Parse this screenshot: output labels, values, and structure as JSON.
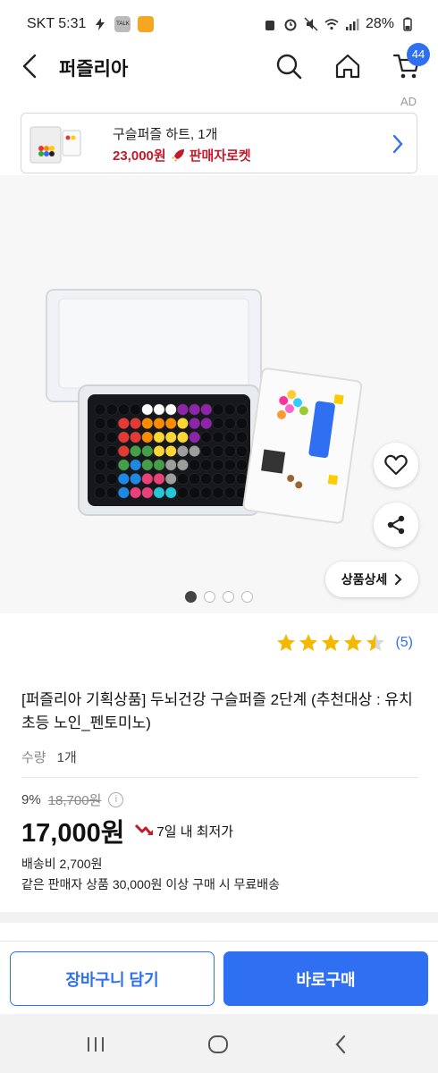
{
  "status_bar": {
    "carrier_time": "SKT 5:31",
    "talk_badge": "TALK",
    "battery": "28%"
  },
  "header": {
    "title": "퍼즐리아",
    "cart_count": "44",
    "icons": [
      "back-arrow-icon",
      "search-icon",
      "home-icon",
      "cart-icon"
    ]
  },
  "ad": {
    "label": "AD",
    "product_name": "구슬퍼즐 하트, 1개",
    "price": "23,000원",
    "badge": "판매자로켓"
  },
  "gallery": {
    "detail_button": "상품상세",
    "dot_count": 4,
    "active_dot": 0
  },
  "rating": {
    "stars": 4.5,
    "review_count": "(5)",
    "star_color": "#f5b800"
  },
  "product": {
    "title": "[퍼즐리아 기획상품] 두뇌건강 구슬퍼즐 2단계 (추천대상 : 유치 초등 노인_펜토미노)",
    "quantity_label": "수량",
    "quantity_value": "1개",
    "discount_rate": "9%",
    "original_price": "18,700원",
    "sale_price": "17,000원",
    "lowest_badge": "7일 내 최저가",
    "shipping_fee": "배송비 2,700원",
    "shipping_note": "같은 판매자 상품 30,000원 이상 구매 시 무료배송"
  },
  "actions": {
    "add_to_cart": "장바구니 담기",
    "buy_now": "바로구매"
  },
  "colors": {
    "accent": "#2f6ff2",
    "rocket_red": "#c51a2b"
  }
}
